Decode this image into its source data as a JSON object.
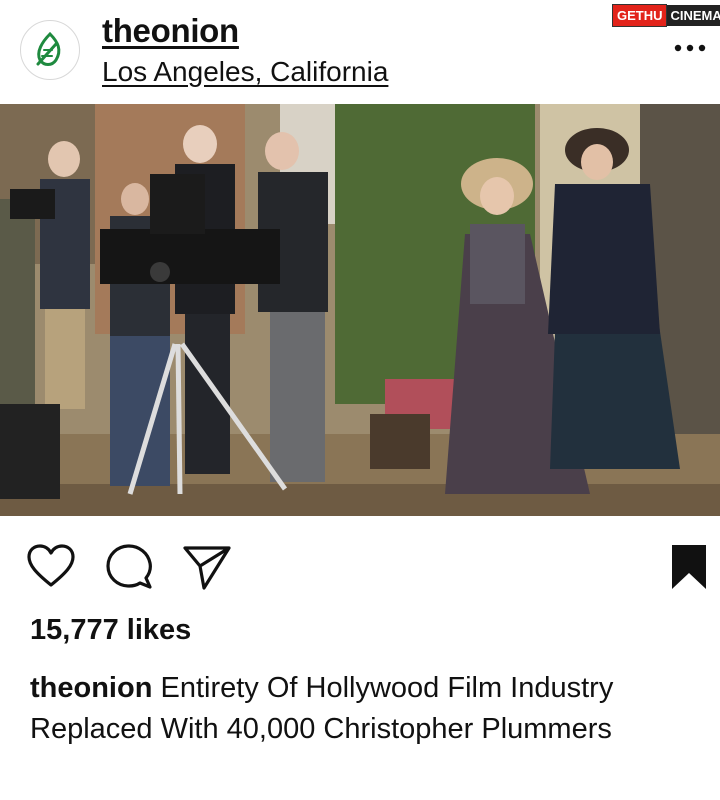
{
  "post": {
    "username": "theonion",
    "location": "Los Angeles, California",
    "more_icon": "ellipsis-icon",
    "likes": "15,777 likes",
    "caption_user": "theonion",
    "caption_text": "Entirety Of Hollywood Film Industry Replaced With 40,000 Christopher Plummers"
  },
  "actions": {
    "like_icon": "heart-icon",
    "comment_icon": "comment-icon",
    "share_icon": "send-icon",
    "save_icon": "bookmark-icon"
  },
  "watermark": {
    "part1": "GETHU",
    "part2": "CINEMA"
  },
  "colors": {
    "text": "#111111",
    "background": "#ffffff",
    "onion_logo_green": "#1f8a3f",
    "watermark_red": "#e2231a"
  }
}
